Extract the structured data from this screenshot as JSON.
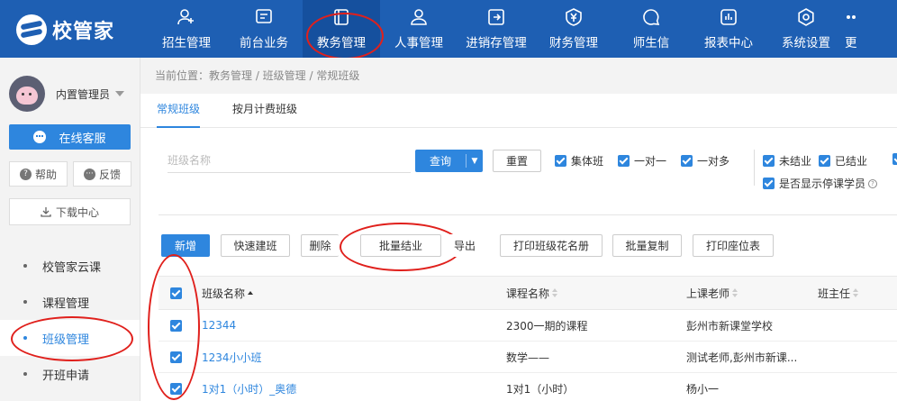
{
  "app": {
    "logo_text": "校管家",
    "brand_color": "#1e5fb3",
    "accent_color": "#2e86de",
    "annotation_color": "#e0201c"
  },
  "nav": [
    {
      "label": "招生管理",
      "icon": "person-add-icon"
    },
    {
      "label": "前台业务",
      "icon": "monitor-icon"
    },
    {
      "label": "教务管理",
      "icon": "book-icon",
      "active": true
    },
    {
      "label": "人事管理",
      "icon": "person-icon"
    },
    {
      "label": "进销存管理",
      "icon": "exchange-icon"
    },
    {
      "label": "财务管理",
      "icon": "yen-shield-icon"
    },
    {
      "label": "师生信",
      "icon": "chat-bubble-icon"
    },
    {
      "label": "报表中心",
      "icon": "bar-chart-icon"
    },
    {
      "label": "系统设置",
      "icon": "gear-icon"
    },
    {
      "label": "更",
      "icon": "more-icon"
    }
  ],
  "sidebar": {
    "user_name": "内置管理员",
    "service_label": "在线客服",
    "help_label": "帮助",
    "feedback_label": "反馈",
    "download_label": "下载中心",
    "menu": [
      {
        "label": "校管家云课"
      },
      {
        "label": "课程管理"
      },
      {
        "label": "班级管理",
        "active": true
      },
      {
        "label": "开班申请"
      }
    ]
  },
  "main": {
    "breadcrumb": "当前位置：教务管理 / 班级管理 / 常规班级",
    "tabs": [
      {
        "label": "常规班级",
        "active": true
      },
      {
        "label": "按月计费班级"
      }
    ],
    "filters": {
      "search_placeholder": "班级名称",
      "query_label": "查询",
      "reset_label": "重置",
      "checkboxes": {
        "group_class": "集体班",
        "one_to_one": "一对一",
        "one_to_many": "一对多",
        "not_graduated": "未结业",
        "graduated": "已结业",
        "show_suspended": "是否显示停课学员"
      }
    },
    "toolbar": {
      "add": "新增",
      "quick_create": "快速建班",
      "delete": "删除",
      "batch_graduate": "批量结业",
      "export": "导出",
      "print_roster": "打印班级花名册",
      "batch_copy": "批量复制",
      "print_seating": "打印座位表"
    },
    "table": {
      "columns": [
        "班级名称",
        "课程名称",
        "上课老师",
        "班主任"
      ],
      "rows": [
        {
          "name": "12344",
          "course": "2300一期的课程",
          "teacher": "彭州市新课堂学校"
        },
        {
          "name": "1234小小班",
          "course": "数学——",
          "teacher": "测试老师,彭州市新课..."
        },
        {
          "name": "1对1（小时）_奥德",
          "course": "1对1（小时）",
          "teacher": "杨小一"
        }
      ]
    }
  }
}
